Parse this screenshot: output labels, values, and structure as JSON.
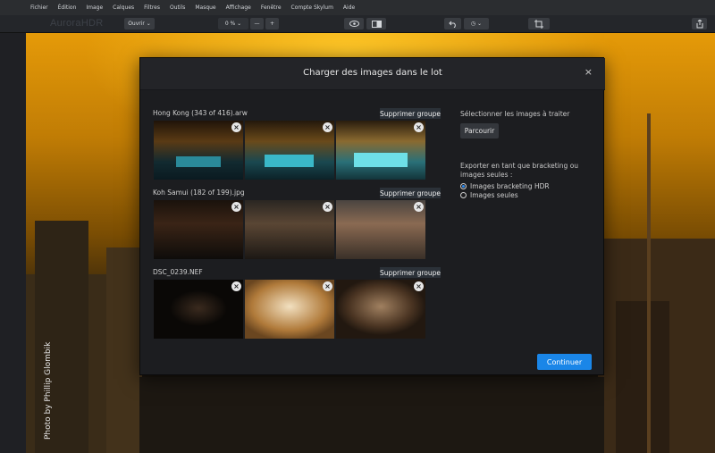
{
  "menu": [
    "Fichier",
    "Édition",
    "Image",
    "Calques",
    "Filtres",
    "Outils",
    "Masque",
    "Affichage",
    "Fenêtre",
    "Compte Skylum",
    "Aide"
  ],
  "toolbar": {
    "logo": "AuroraHDR",
    "open_label": "Ouvrir ⌄",
    "zoom_label": "0 % ⌄",
    "zoom_out": "—",
    "zoom_in": "+",
    "history_label": "◷ ⌄"
  },
  "canvas": {
    "credit": "Photo by Phillip Glombik"
  },
  "dialog": {
    "title": "Charger des images dans le lot",
    "close": "×",
    "groups": [
      {
        "name": "Hong Kong (343 of 416).arw",
        "remove_label": "Supprimer groupe"
      },
      {
        "name": "Koh Samui (182 of 199).jpg",
        "remove_label": "Supprimer groupe"
      },
      {
        "name": "DSC_0239.NEF",
        "remove_label": "Supprimer groupe"
      }
    ],
    "select_label": "Sélectionner les images à traiter",
    "browse_label": "Parcourir",
    "export_label_line1": "Exporter en tant que bracketing ou",
    "export_label_line2": "images seules :",
    "option_hdr": "Images bracketing HDR",
    "option_single": "Images seules",
    "continue_label": "Continuer"
  }
}
